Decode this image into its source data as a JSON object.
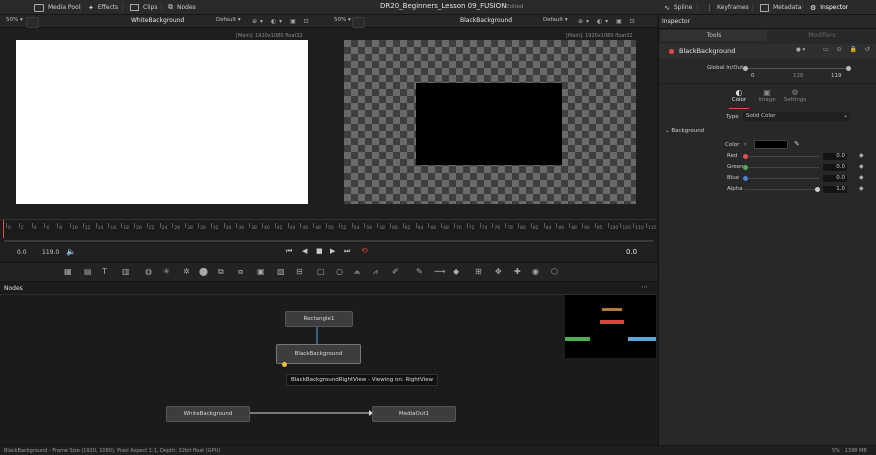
{
  "topbar": {
    "left": [
      {
        "label": "Media Pool",
        "icon": "media-pool-icon"
      },
      {
        "label": "Effects",
        "icon": "effects-icon"
      },
      {
        "label": "Clips",
        "icon": "clips-icon"
      },
      {
        "label": "Nodes",
        "icon": "nodes-icon"
      }
    ],
    "title": "DR20_Beginners_Lesson 09_FUSION",
    "title_status": "Edited",
    "right": [
      {
        "label": "Spline",
        "icon": "spline-icon"
      },
      {
        "label": "Keyframes",
        "icon": "keyframes-icon"
      },
      {
        "label": "Metadata",
        "icon": "metadata-icon"
      },
      {
        "label": "Inspector",
        "icon": "inspector-icon"
      }
    ]
  },
  "viewer_left": {
    "zoom": "50%",
    "title": "WhiteBackground",
    "preset": "Default",
    "info": "[Main]: 1920x1080 float32"
  },
  "viewer_right": {
    "zoom": "50%",
    "title": "BlackBackground",
    "preset": "Default",
    "info": "[Main]: 1920x1080 float32"
  },
  "timeline": {
    "ticks": [
      "0",
      "2",
      "4",
      "6",
      "8",
      "10",
      "12",
      "14",
      "16",
      "18",
      "20",
      "22",
      "24",
      "26",
      "28",
      "30",
      "32",
      "34",
      "36",
      "38",
      "40",
      "42",
      "44",
      "46",
      "48",
      "50",
      "52",
      "54",
      "56",
      "58",
      "60",
      "62",
      "64",
      "66",
      "68",
      "70",
      "72",
      "74",
      "76",
      "78",
      "80",
      "82",
      "84",
      "86",
      "88",
      "90",
      "95",
      "100",
      "105",
      "110",
      "115"
    ],
    "start": "0.0",
    "end": "119.0",
    "current": "0.0"
  },
  "nodes_panel": {
    "title": "Nodes",
    "nodes": {
      "rect": "Rectangle1",
      "black": "BlackBackground",
      "white": "WhiteBackground",
      "out": "MediaOut1"
    },
    "tooltip": "BlackBackgroundRightView - Viewing on: RightView"
  },
  "statusbar": {
    "left": "BlackBackground - Frame Size (1920, 1080), Pixel Aspect 1:1, Depth: 32bit float (GPU)",
    "right": "5% · 1398 MB"
  },
  "inspector": {
    "header": "Inspector",
    "tabs": [
      "Tools",
      "Modifiers"
    ],
    "node_name": "BlackBackground",
    "global_inout_label": "Global In/Out",
    "inout_values": [
      "0",
      "120",
      "119"
    ],
    "subtabs": [
      "Color",
      "Image",
      "Settings"
    ],
    "type_label": "Type",
    "type_value": "Solid Color",
    "section": "Background",
    "rows": [
      {
        "label": "Color"
      },
      {
        "label": "Red",
        "value": "0.0",
        "color": "#e05050"
      },
      {
        "label": "Green",
        "value": "0.0",
        "color": "#4caf50"
      },
      {
        "label": "Blue",
        "value": "0.0",
        "color": "#4a7fd6"
      },
      {
        "label": "Alpha",
        "value": "1.0",
        "color": "#cccccc"
      }
    ]
  },
  "colors": {
    "accent": "#e64b3c",
    "node_select": "#f0c040"
  }
}
